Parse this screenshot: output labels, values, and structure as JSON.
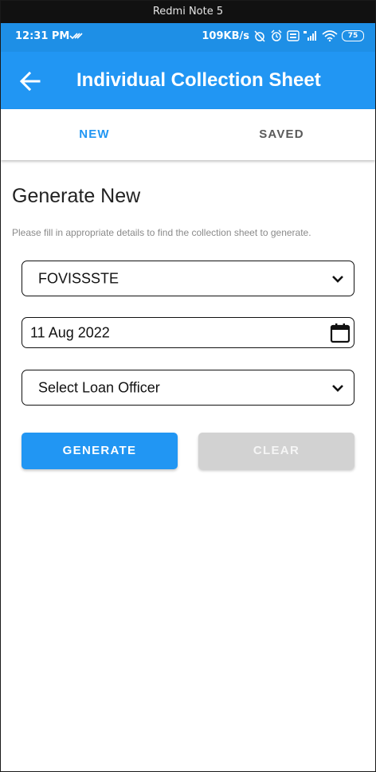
{
  "device": {
    "name": "Redmi Note 5"
  },
  "status_bar": {
    "time": "12:31 PM",
    "speed": "109KB/s",
    "battery": "75"
  },
  "app_bar": {
    "title": "Individual Collection Sheet"
  },
  "tabs": [
    {
      "label": "NEW",
      "selected": true
    },
    {
      "label": "SAVED",
      "selected": false
    }
  ],
  "form": {
    "heading": "Generate New",
    "instructions": "Please fill in appropriate details to find the collection sheet to generate.",
    "branch_value": "FOVISSSTE",
    "date_value": "11 Aug 2022",
    "officer_placeholder": "Select Loan Officer"
  },
  "buttons": {
    "generate": "GENERATE",
    "clear": "CLEAR"
  },
  "icons": {
    "back": "arrow-back-icon",
    "calendar": "calendar-icon",
    "dropdown": "chevron-down-icon"
  },
  "colors": {
    "primary": "#2196f3",
    "status_bar": "#1e8fe6",
    "disabled_button": "#d2d2d2"
  }
}
